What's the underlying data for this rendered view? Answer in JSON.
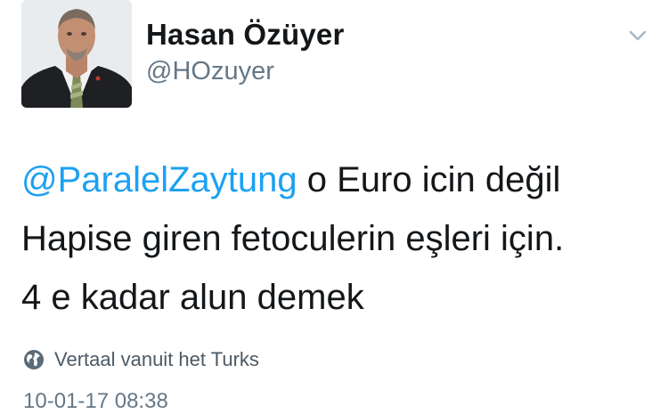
{
  "tweet": {
    "author_name": "Hasan Özüyer",
    "author_handle": "@HOzuyer",
    "mention": "@ParalelZaytung",
    "line1_rest": " o Euro icin değil",
    "line2": "Hapise giren fetoculerin eşleri için.",
    "line3": "4 e kadar alun demek",
    "translate_label": "Vertaal vanuit het Turks",
    "timestamp": "10-01-17 08:38"
  },
  "colors": {
    "link": "#1da1f2",
    "secondary_text": "#657786",
    "primary_text": "#14171a"
  },
  "icons": {
    "caret": "chevron-down-icon",
    "translate": "globe-icon"
  }
}
